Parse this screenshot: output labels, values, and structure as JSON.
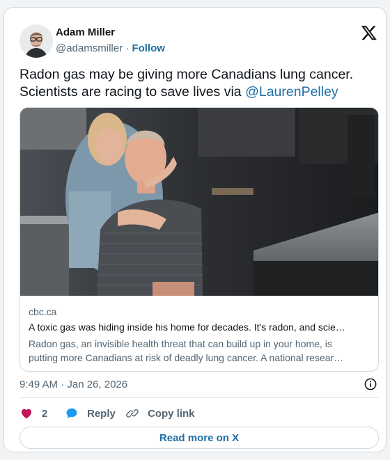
{
  "author": {
    "name": "Adam Miller",
    "handle": "@adamsmiller",
    "separator": "·",
    "follow_label": "Follow"
  },
  "tweet": {
    "text": "Radon gas may be giving more Canadians lung cancer. Scientists are racing to save lives via",
    "mention": "@LaurenPelley"
  },
  "link_card": {
    "domain": "cbc.ca",
    "title": "A toxic gas was hiding inside his home for decades. It's radon, and scie…",
    "description_line1": "Radon gas, an invisible health threat that can build up in your home, is",
    "description_line2": "putting more Canadians at risk of deadly lung cancer. A national resear…"
  },
  "meta": {
    "timestamp": "9:49 AM · Jan 26, 2026"
  },
  "actions": {
    "likes_count": "2",
    "reply_label": "Reply",
    "copy_link_label": "Copy link"
  },
  "read_more_label": "Read more on X",
  "colors": {
    "link": "#1d6fa5",
    "heart": "#c2185b",
    "reply": "#1d9bf0",
    "text": "#0f1419",
    "muted": "#536471"
  }
}
